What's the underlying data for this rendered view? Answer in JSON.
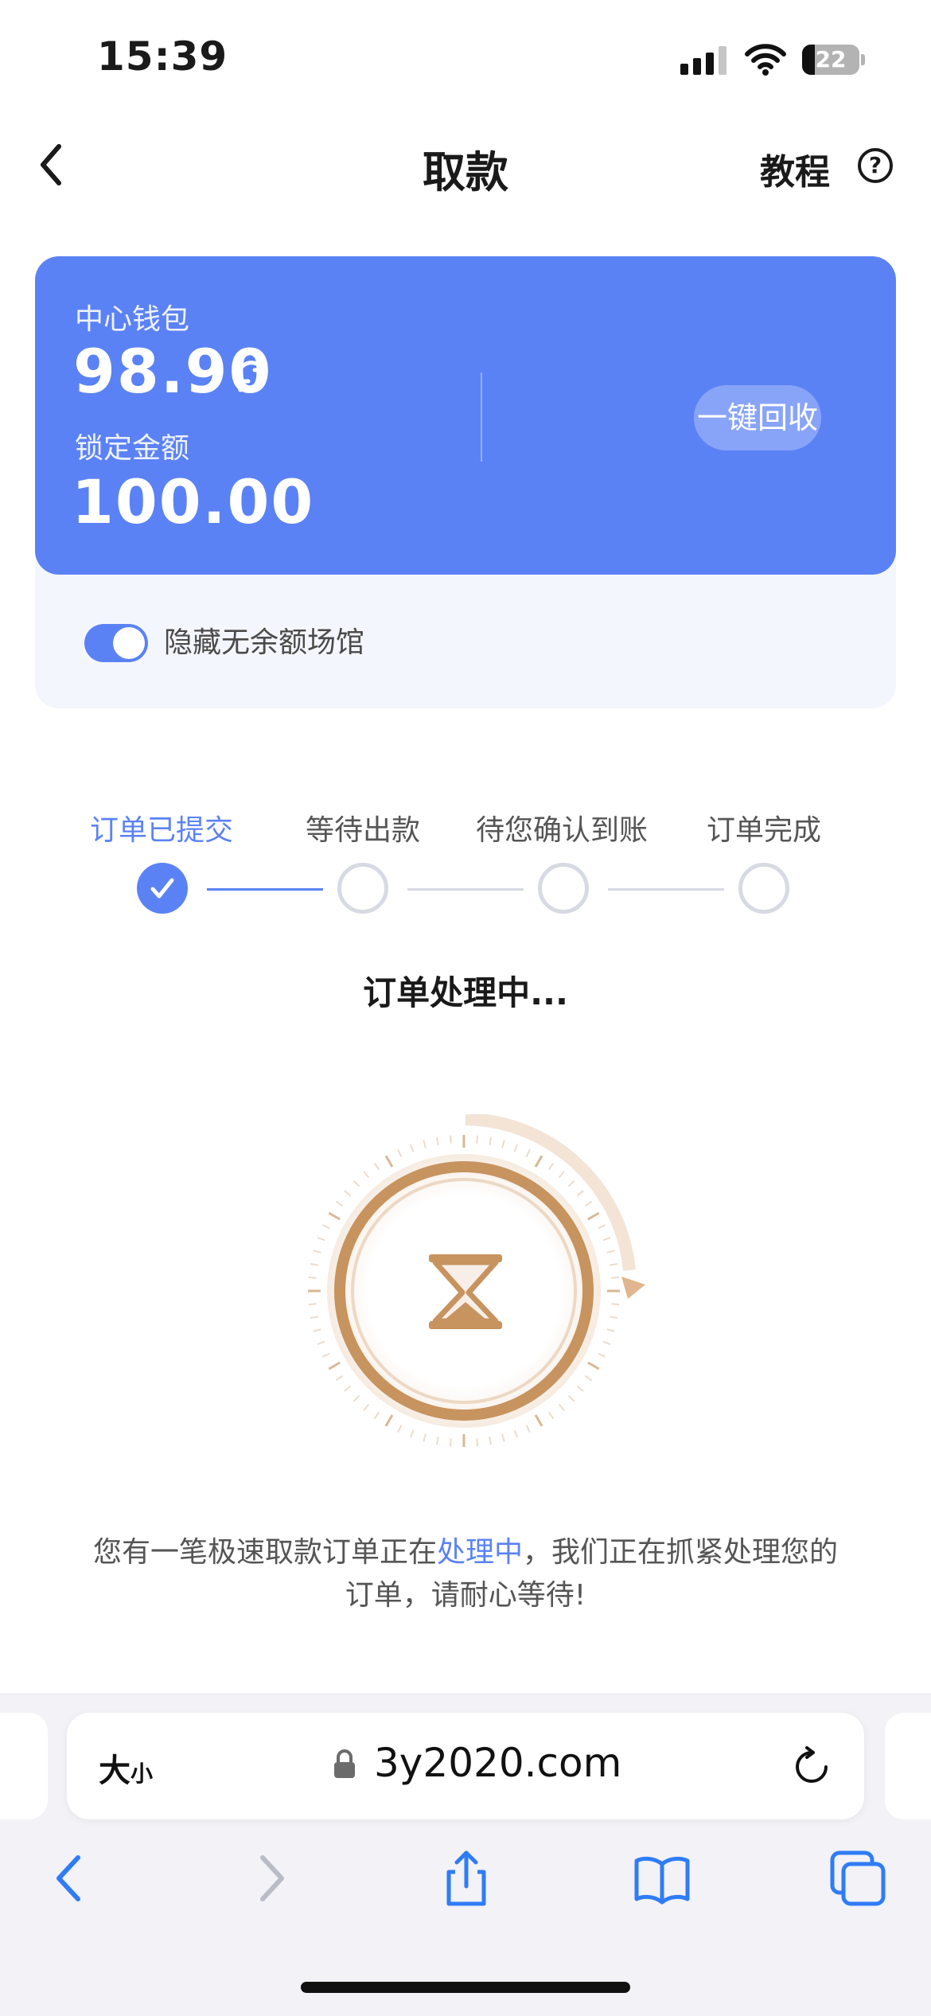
{
  "status_bar": {
    "time": "15:39",
    "battery": "22",
    "battery_level": 0.22
  },
  "nav": {
    "title": "取款",
    "tutorial_label": "教程"
  },
  "wallet": {
    "center_wallet_label": "中心钱包",
    "center_wallet_amount": "98.90",
    "locked_label": "锁定金额",
    "locked_amount": "100.00",
    "recover_button": "一键回收"
  },
  "hide_toggle": {
    "label": "隐藏无余额场馆",
    "on": true
  },
  "steps": [
    {
      "label": "订单已提交",
      "status": "done"
    },
    {
      "label": "等待出款",
      "status": "pending"
    },
    {
      "label": "待您确认到账",
      "status": "pending"
    },
    {
      "label": "订单完成",
      "status": "pending"
    }
  ],
  "processing_title": "订单处理中...",
  "message": {
    "part1": "您有一笔极速取款订单正在",
    "highlight": "处理中",
    "part2": "，我们正在抓紧处理您的订单，请耐心等待!"
  },
  "browser": {
    "text_size_big": "大",
    "text_size_small": "小",
    "url": "3y2020.com"
  },
  "colors": {
    "accent": "#5b82f5",
    "timer": "#c7935f"
  }
}
